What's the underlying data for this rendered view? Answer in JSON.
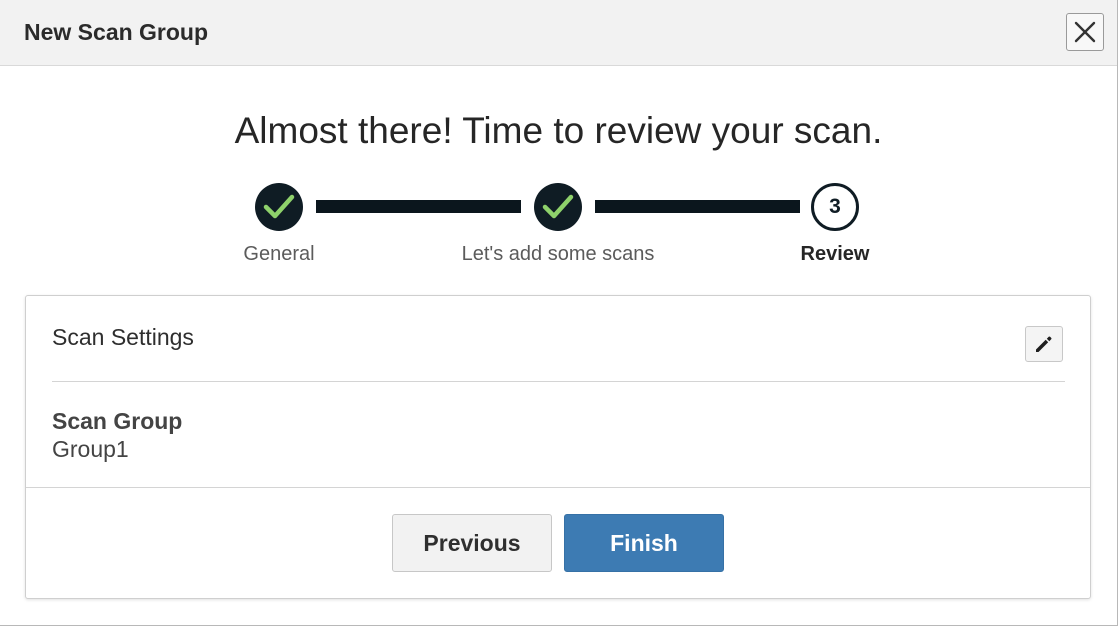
{
  "dialog": {
    "title": "New Scan Group",
    "close_icon": "close-icon"
  },
  "wizard": {
    "headline": "Almost there! Time to review your scan.",
    "steps": [
      {
        "label": "General",
        "state": "complete",
        "icon": "check-icon"
      },
      {
        "label": "Let's add some scans",
        "state": "complete",
        "icon": "check-icon"
      },
      {
        "label": "Review",
        "state": "current",
        "number": "3"
      }
    ]
  },
  "review": {
    "section_title": "Scan Settings",
    "edit_icon": "pencil-icon",
    "fields": [
      {
        "label": "Scan Group",
        "value": "Group1"
      }
    ]
  },
  "footer": {
    "previous_label": "Previous",
    "finish_label": "Finish"
  },
  "colors": {
    "step_fill": "#0f1c24",
    "check": "#8ed16b",
    "finish_button": "#3d7bb3"
  }
}
